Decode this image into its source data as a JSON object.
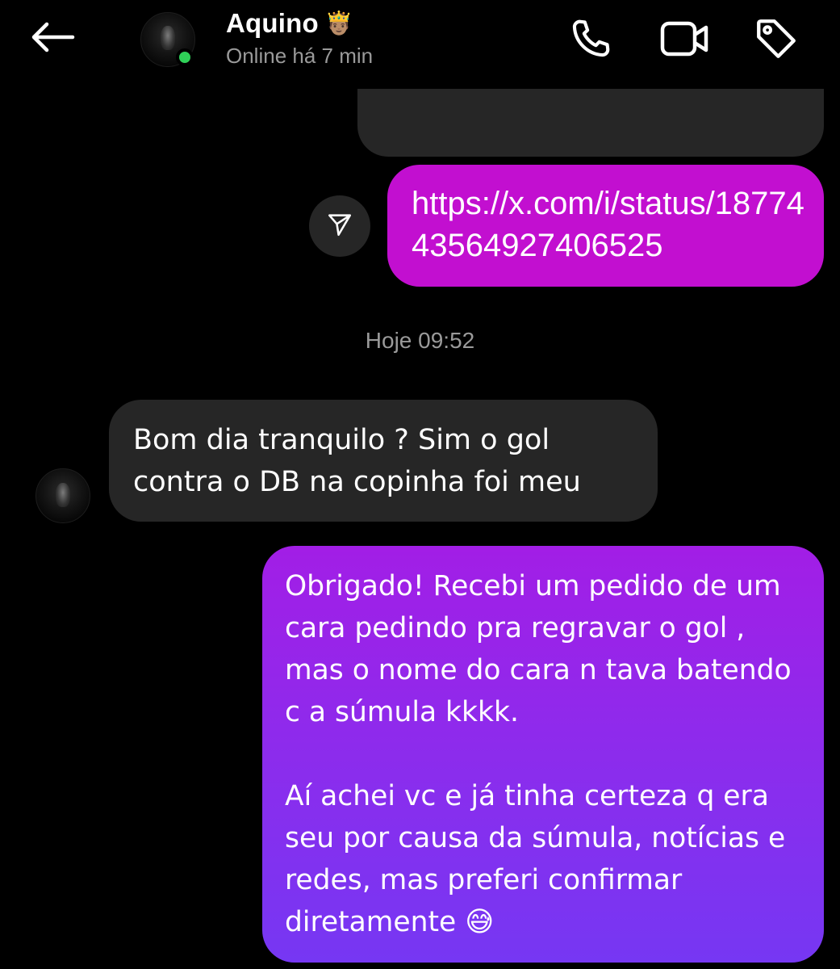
{
  "header": {
    "contact_name": "Aquino",
    "name_emoji": "🤴🏽",
    "status": "Online há 7 min",
    "icons": [
      "back-arrow-icon",
      "phone-icon",
      "video-icon",
      "tag-icon"
    ]
  },
  "messages": {
    "link_text": "https://x.com/i/status/1877443564927406525",
    "timestamp": "Hoje 09:52",
    "incoming_text": "Bom dia tranquilo ? Sim o gol contra o DB na copinha foi meu",
    "outgoing_paragraph_1": "Obrigado! Recebi um pedido de um cara pedindo pra regravar o gol , mas o nome do cara n tava batendo c a súmula kkkk.",
    "outgoing_paragraph_2": "Aí achei vc e já tinha certeza q era seu por causa da súmula, notícias e redes, mas preferi confirmar diretamente 😅"
  },
  "colors": {
    "background": "#000000",
    "incoming_bubble": "#262626",
    "link_bubble": "#c20fd0",
    "outgoing_gradient_top": "#a21ee6",
    "outgoing_gradient_bottom": "#7637f3",
    "online_indicator": "#2fd158",
    "muted_text": "#9a9a9a"
  }
}
